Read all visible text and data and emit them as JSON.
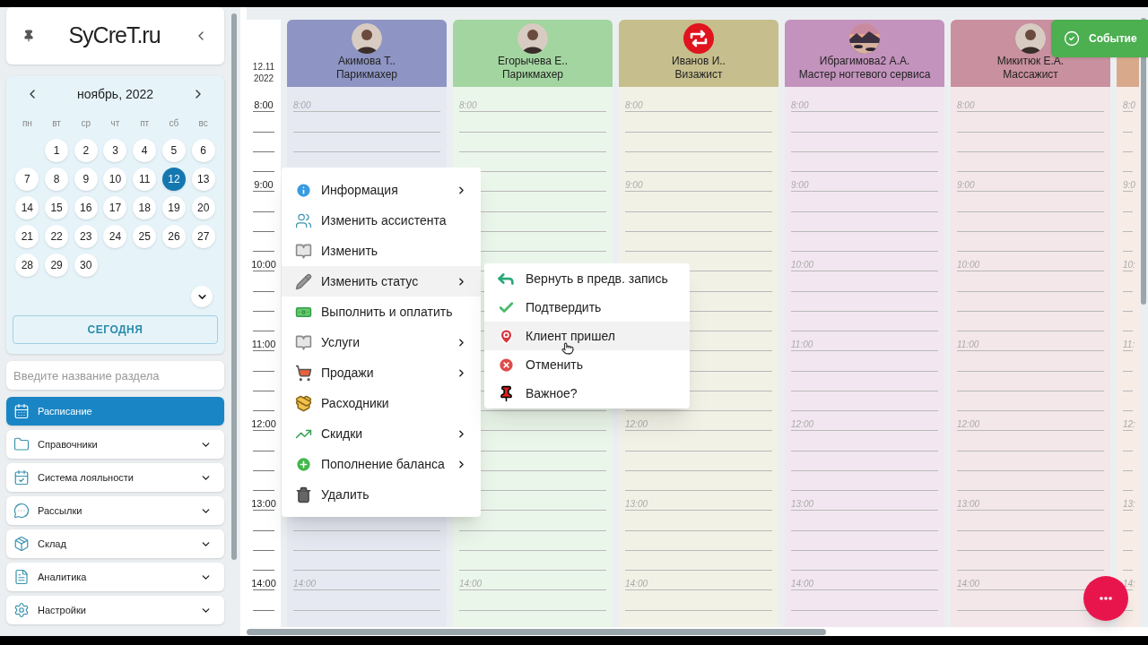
{
  "sidebar": {
    "logo": "SyCreT.ru",
    "calendar": {
      "month": "ноябрь, 2022",
      "weekdays": [
        "пн",
        "вт",
        "ср",
        "чт",
        "пт",
        "сб",
        "вс"
      ],
      "weeks": [
        [
          {
            "day": "1",
            "selected": false
          },
          {
            "day": "2",
            "selected": false
          },
          {
            "day": "3",
            "selected": false
          },
          {
            "day": "4",
            "selected": false
          },
          {
            "day": "5",
            "selected": false
          },
          {
            "day": "6",
            "selected": false
          }
        ],
        [
          {
            "day": "7",
            "selected": false
          },
          {
            "day": "8",
            "selected": false
          },
          {
            "day": "9",
            "selected": false
          },
          {
            "day": "10",
            "selected": false
          },
          {
            "day": "11",
            "selected": false
          },
          {
            "day": "12",
            "selected": true
          },
          {
            "day": "13",
            "selected": false
          }
        ],
        [
          {
            "day": "14",
            "selected": false
          },
          {
            "day": "15",
            "selected": false
          },
          {
            "day": "16",
            "selected": false
          },
          {
            "day": "17",
            "selected": false
          },
          {
            "day": "18",
            "selected": false
          },
          {
            "day": "19",
            "selected": false
          },
          {
            "day": "20",
            "selected": false
          }
        ],
        [
          {
            "day": "21",
            "selected": false
          },
          {
            "day": "22",
            "selected": false
          },
          {
            "day": "23",
            "selected": false
          },
          {
            "day": "24",
            "selected": false
          },
          {
            "day": "25",
            "selected": false
          },
          {
            "day": "26",
            "selected": false
          },
          {
            "day": "27",
            "selected": false
          }
        ],
        [
          {
            "day": "28",
            "selected": false
          },
          {
            "day": "29",
            "selected": false
          },
          {
            "day": "30",
            "selected": false
          }
        ]
      ],
      "today_button": "СЕГОДНЯ"
    },
    "search": {
      "placeholder": "Введите название раздела"
    },
    "nav": [
      {
        "label": "Расписание",
        "selected": true,
        "expandable": false
      },
      {
        "label": "Справочники",
        "selected": false,
        "expandable": true
      },
      {
        "label": "Система лояльности",
        "selected": false,
        "expandable": true
      },
      {
        "label": "Рассылки",
        "selected": false,
        "expandable": true
      },
      {
        "label": "Склад",
        "selected": false,
        "expandable": true
      },
      {
        "label": "Аналитика",
        "selected": false,
        "expandable": true
      },
      {
        "label": "Настройки",
        "selected": false,
        "expandable": true
      }
    ]
  },
  "schedule": {
    "date": [
      "12.11",
      "2022"
    ],
    "times": [
      "8:00",
      "9:00",
      "10:00",
      "11:00",
      "12:00",
      "13:00",
      "14:00"
    ],
    "staff": [
      {
        "name": "Акимова Т..",
        "role": "Парикмахер",
        "color": "#8e95c4",
        "top_labels": [
          "8:00"
        ],
        "bottom_labels": [
          "14:00"
        ]
      },
      {
        "name": "Егорычева Е..",
        "role": "Парикмахер",
        "color": "#a3d5a0",
        "top_labels": [
          "8:00"
        ],
        "bottom_labels": [
          "14:00"
        ]
      },
      {
        "name": "Иванов И..",
        "role": "Визажист",
        "color": "#c6be8c",
        "top_labels": [
          "8:00",
          "9:00"
        ],
        "bottom_labels": [
          "12:00",
          "13:00",
          "14:00"
        ]
      },
      {
        "name": "Ибрагимова2 А.А.",
        "role": "Мастер ногтевого сервиса",
        "color": "#c393bd",
        "top_labels": [
          "8:00",
          "9:00",
          "10:00",
          "11:00",
          "12:00",
          "13:00",
          "14:00"
        ]
      },
      {
        "name": "Микитюк Е.А.",
        "role": "Массажист",
        "color": "#c9909f",
        "top_labels": [
          "8:00",
          "9:00",
          "10:00",
          "11:00",
          "12:00",
          "13:00",
          "14:00"
        ]
      },
      {
        "partial": true,
        "color": "#d9a98c",
        "top_labels": [
          "8:0",
          "9:0",
          "10:",
          "11:",
          "12:",
          "13:",
          "14:"
        ]
      }
    ],
    "event_button": "Событие"
  },
  "context_menu": [
    {
      "label": "Информация",
      "submenu": true,
      "selected": false
    },
    {
      "label": "Изменить ассистента",
      "submenu": false,
      "selected": false
    },
    {
      "label": "Изменить",
      "submenu": false,
      "selected": false
    },
    {
      "label": "Изменить статус",
      "submenu": true,
      "selected": true
    },
    {
      "label": "Выполнить и оплатить",
      "submenu": false,
      "selected": false
    },
    {
      "label": "Услуги",
      "submenu": true,
      "selected": false
    },
    {
      "label": "Продажи",
      "submenu": true,
      "selected": false
    },
    {
      "label": "Расходники",
      "submenu": false,
      "selected": false
    },
    {
      "label": "Скидки",
      "submenu": true,
      "selected": false
    },
    {
      "label": "Пополнение баланса",
      "submenu": true,
      "selected": false
    },
    {
      "label": "Удалить",
      "submenu": false,
      "selected": false
    }
  ],
  "status_submenu": [
    {
      "label": "Вернуть в предв. запись",
      "selected": false
    },
    {
      "label": "Подтвердить",
      "selected": false
    },
    {
      "label": "Клиент пришел",
      "selected": true
    },
    {
      "label": "Отменить",
      "selected": false
    },
    {
      "label": "Важное?",
      "selected": false
    }
  ]
}
